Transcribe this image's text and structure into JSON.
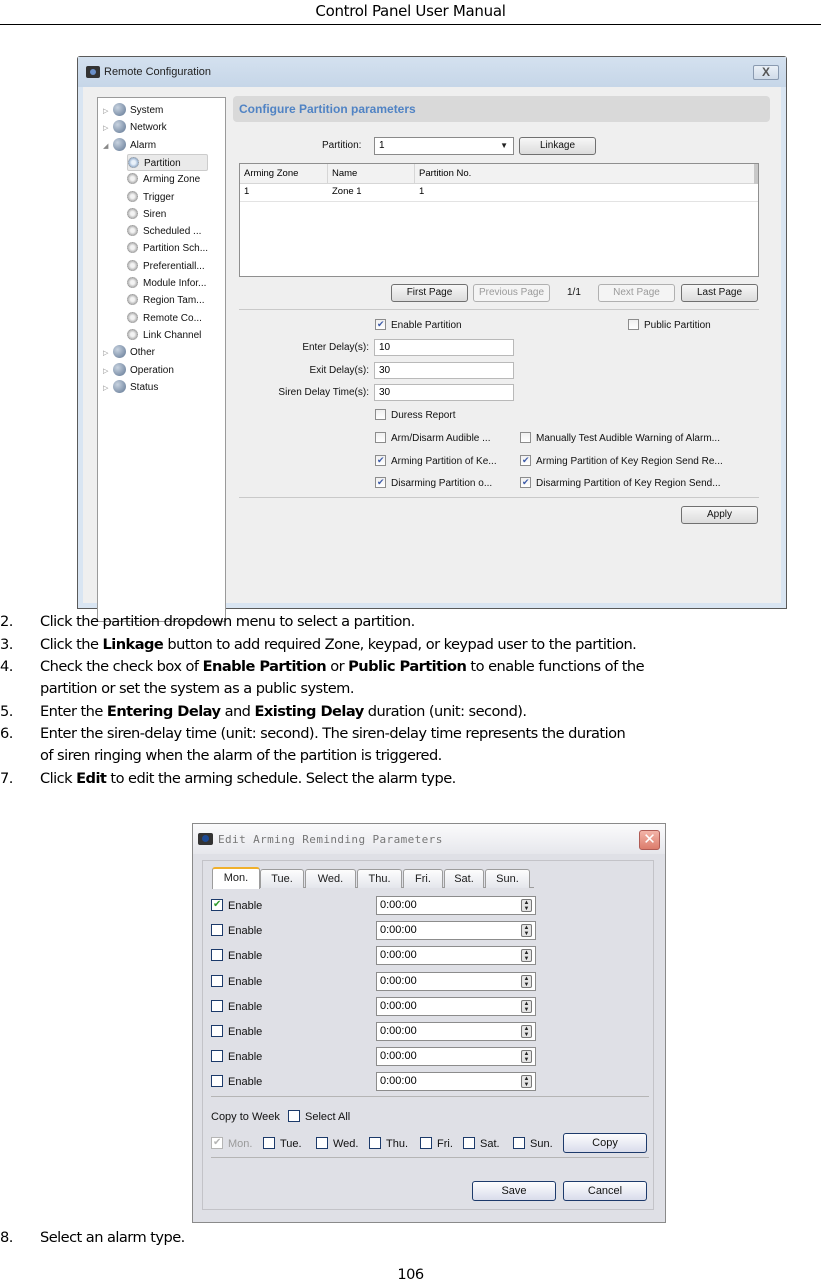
{
  "header": {
    "title": "Control Panel User Manual"
  },
  "remote_config": {
    "window_title": "Remote Configuration",
    "close_label": "X",
    "tree": [
      {
        "label": "System",
        "level": 0,
        "expander": "▷"
      },
      {
        "label": "Network",
        "level": 0,
        "expander": "▷"
      },
      {
        "label": "Alarm",
        "level": 0,
        "expander": "◢"
      },
      {
        "label": "Partition",
        "level": 1,
        "selected": true
      },
      {
        "label": "Arming Zone",
        "level": 1
      },
      {
        "label": "Trigger",
        "level": 1
      },
      {
        "label": "Siren",
        "level": 1
      },
      {
        "label": "Scheduled ...",
        "level": 1
      },
      {
        "label": "Partition Sch...",
        "level": 1
      },
      {
        "label": "Preferentiall...",
        "level": 1
      },
      {
        "label": "Module Infor...",
        "level": 1
      },
      {
        "label": "Region Tam...",
        "level": 1
      },
      {
        "label": "Remote Co...",
        "level": 1
      },
      {
        "label": "Link Channel",
        "level": 1
      },
      {
        "label": "Other",
        "level": 0,
        "expander": "▷"
      },
      {
        "label": "Operation",
        "level": 0,
        "expander": "▷"
      },
      {
        "label": "Status",
        "level": 0,
        "expander": "▷"
      }
    ],
    "section_title": "Configure Partition parameters",
    "partition_label": "Partition:",
    "partition_value": "1",
    "dropdown_arrow": "▼",
    "linkage_button": "Linkage",
    "table": {
      "columns": [
        "Arming Zone",
        "Name",
        "Partition No."
      ],
      "rows": [
        [
          "1",
          "Zone 1",
          "1"
        ]
      ]
    },
    "pager": {
      "first": "First Page",
      "previous": "Previous Page",
      "page_indicator": "1/1",
      "next": "Next Page",
      "last": "Last Page"
    },
    "enable_partition": {
      "label": "Enable Partition",
      "checked": true
    },
    "public_partition": {
      "label": "Public Partition",
      "checked": false
    },
    "enter_delay": {
      "label": "Enter Delay(s):",
      "value": "10"
    },
    "exit_delay": {
      "label": "Exit Delay(s):",
      "value": "30"
    },
    "siren_delay": {
      "label": "Siren Delay Time(s):",
      "value": "30"
    },
    "duress_report": {
      "label": "Duress Report",
      "checked": false
    },
    "options_left": [
      {
        "label": "Arm/Disarm Audible ...",
        "checked": false
      },
      {
        "label": "Arming Partition of Ke...",
        "checked": true
      },
      {
        "label": "Disarming Partition o...",
        "checked": true
      }
    ],
    "options_right": [
      {
        "label": "Manually Test Audible Warning of Alarm...",
        "checked": false
      },
      {
        "label": "Arming Partition of Key Region Send Re...",
        "checked": true
      },
      {
        "label": "Disarming Partition of Key Region Send...",
        "checked": true
      }
    ],
    "apply_button": "Apply"
  },
  "steps": [
    {
      "num": "2.",
      "parts": [
        {
          "t": "Click the partition dropdown menu to select a partition."
        }
      ]
    },
    {
      "num": "3.",
      "parts": [
        {
          "t": "Click the "
        },
        {
          "t": "Linkage",
          "b": true
        },
        {
          "t": " button to add required Zone, keypad, or keypad user to the partition."
        }
      ]
    },
    {
      "num": "4.",
      "parts": [
        {
          "t": "Check the check box of "
        },
        {
          "t": "Enable Partition",
          "b": true
        },
        {
          "t": " or "
        },
        {
          "t": "Public Partition",
          "b": true
        },
        {
          "t": " to enable functions of the"
        }
      ]
    },
    {
      "num": "",
      "parts": [
        {
          "t": "partition or set the system as a public system."
        }
      ]
    },
    {
      "num": "5.",
      "parts": [
        {
          "t": "Enter the "
        },
        {
          "t": "Entering Delay",
          "b": true
        },
        {
          "t": " and "
        },
        {
          "t": "Existing Delay",
          "b": true
        },
        {
          "t": " duration (unit: second)."
        }
      ]
    },
    {
      "num": "6.",
      "parts": [
        {
          "t": "Enter the siren-delay time (unit: second). The siren-delay time represents the duration"
        }
      ]
    },
    {
      "num": "",
      "parts": [
        {
          "t": "of siren ringing when the alarm of the partition is triggered."
        }
      ]
    },
    {
      "num": "7.",
      "parts": [
        {
          "t": "Click "
        },
        {
          "t": "Edit",
          "b": true
        },
        {
          "t": " to edit the arming schedule. Select the alarm type."
        }
      ]
    }
  ],
  "edit_arming": {
    "window_title": "Edit Arming Reminding Parameters",
    "close_label": "✕",
    "tabs": [
      {
        "label": "Mon.",
        "active": true
      },
      {
        "label": "Tue."
      },
      {
        "label": "Wed."
      },
      {
        "label": "Thu."
      },
      {
        "label": "Fri."
      },
      {
        "label": "Sat."
      },
      {
        "label": "Sun."
      }
    ],
    "rows": [
      {
        "label": "Enable",
        "checked": true,
        "time": "0:00:00"
      },
      {
        "label": "Enable",
        "checked": false,
        "time": "0:00:00"
      },
      {
        "label": "Enable",
        "checked": false,
        "time": "0:00:00"
      },
      {
        "label": "Enable",
        "checked": false,
        "time": "0:00:00"
      },
      {
        "label": "Enable",
        "checked": false,
        "time": "0:00:00"
      },
      {
        "label": "Enable",
        "checked": false,
        "time": "0:00:00"
      },
      {
        "label": "Enable",
        "checked": false,
        "time": "0:00:00"
      },
      {
        "label": "Enable",
        "checked": false,
        "time": "0:00:00"
      }
    ],
    "spin_up": "▲",
    "spin_down": "▼",
    "copy_to_week_label": "Copy to Week",
    "select_all": {
      "label": "Select All",
      "checked": false
    },
    "copy_days": [
      {
        "label": "Mon.",
        "checked": true,
        "disabled": true
      },
      {
        "label": "Tue.",
        "checked": false
      },
      {
        "label": "Wed.",
        "checked": false
      },
      {
        "label": "Thu.",
        "checked": false
      },
      {
        "label": "Fri.",
        "checked": false
      },
      {
        "label": "Sat.",
        "checked": false
      },
      {
        "label": "Sun.",
        "checked": false
      }
    ],
    "copy_button": "Copy",
    "save_button": "Save",
    "cancel_button": "Cancel"
  },
  "final_step": {
    "num": "8.",
    "text": "Select an alarm type."
  },
  "page_number": "106"
}
